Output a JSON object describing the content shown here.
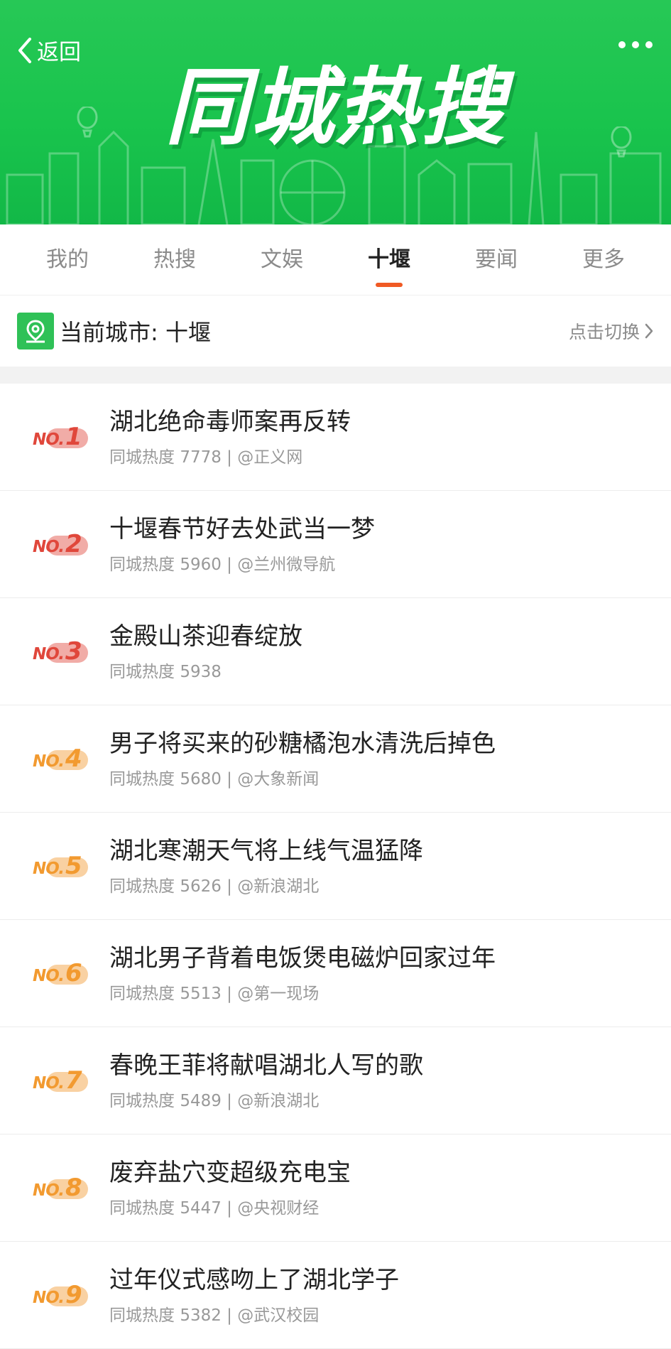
{
  "header": {
    "back_label": "返回",
    "title": "同城热搜"
  },
  "tabs": [
    {
      "label": "我的"
    },
    {
      "label": "热搜"
    },
    {
      "label": "文娱"
    },
    {
      "label": "十堰",
      "active": true
    },
    {
      "label": "要闻"
    },
    {
      "label": "更多"
    }
  ],
  "city": {
    "label": "当前城市: 十堰",
    "switch_label": "点击切换"
  },
  "colors": {
    "brand_green": "#1cc450",
    "accent_orange": "#f05a24",
    "rank_red": "#e0473b",
    "rank_orange": "#f29a30"
  },
  "list": [
    {
      "rank_prefix": "NO.",
      "rank": "1",
      "title": "湖北绝命毒师案再反转",
      "heat_label": "同城热度",
      "heat": "7778",
      "source": "| @正义网"
    },
    {
      "rank_prefix": "NO.",
      "rank": "2",
      "title": "十堰春节好去处武当一梦",
      "heat_label": "同城热度",
      "heat": "5960",
      "source": "| @兰州微导航"
    },
    {
      "rank_prefix": "NO.",
      "rank": "3",
      "title": "金殿山茶迎春绽放",
      "heat_label": "同城热度",
      "heat": "5938",
      "source": ""
    },
    {
      "rank_prefix": "NO.",
      "rank": "4",
      "title": "男子将买来的砂糖橘泡水清洗后掉色",
      "heat_label": "同城热度",
      "heat": "5680",
      "source": "| @大象新闻"
    },
    {
      "rank_prefix": "NO.",
      "rank": "5",
      "title": "湖北寒潮天气将上线气温猛降",
      "heat_label": "同城热度",
      "heat": "5626",
      "source": "| @新浪湖北"
    },
    {
      "rank_prefix": "NO.",
      "rank": "6",
      "title": "湖北男子背着电饭煲电磁炉回家过年",
      "heat_label": "同城热度",
      "heat": "5513",
      "source": "| @第一现场"
    },
    {
      "rank_prefix": "NO.",
      "rank": "7",
      "title": "春晚王菲将献唱湖北人写的歌",
      "heat_label": "同城热度",
      "heat": "5489",
      "source": "| @新浪湖北"
    },
    {
      "rank_prefix": "NO.",
      "rank": "8",
      "title": "废弃盐穴变超级充电宝",
      "heat_label": "同城热度",
      "heat": "5447",
      "source": "| @央视财经"
    },
    {
      "rank_prefix": "NO.",
      "rank": "9",
      "title": "过年仪式感吻上了湖北学子",
      "heat_label": "同城热度",
      "heat": "5382",
      "source": "| @武汉校园"
    }
  ]
}
